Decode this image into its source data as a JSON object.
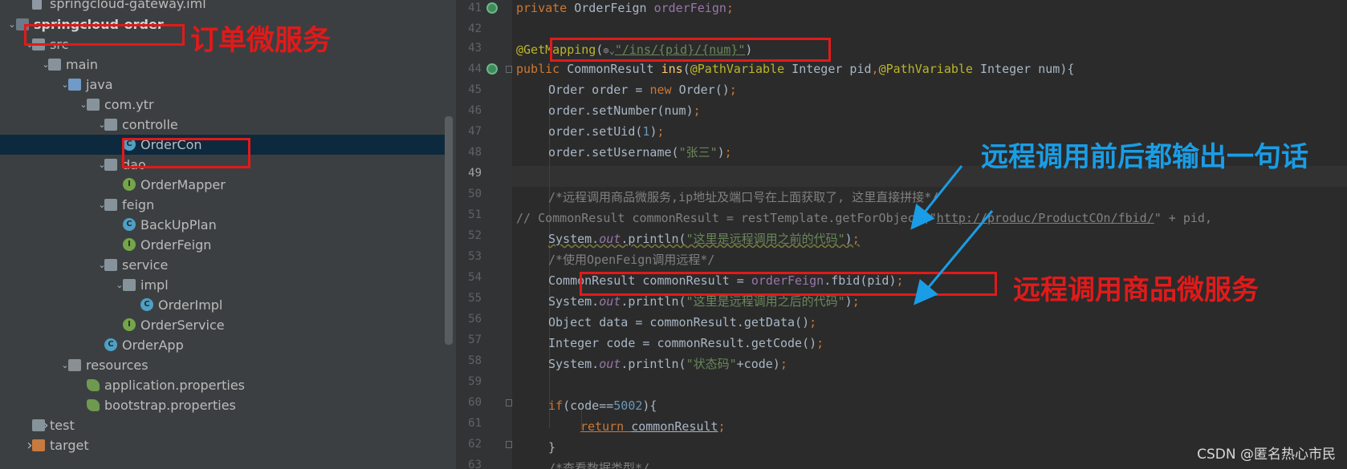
{
  "tree": {
    "items": [
      {
        "label": "springcloud-gateway.iml",
        "icon": "iml-file-icon",
        "arrow": ""
      },
      {
        "label": "springcloud-order",
        "icon": "module-folder-icon",
        "arrow": "expanded"
      },
      {
        "label": "src",
        "icon": "folder-icon",
        "arrow": "expanded"
      },
      {
        "label": "main",
        "icon": "folder-icon",
        "arrow": "expanded"
      },
      {
        "label": "java",
        "icon": "source-folder-icon",
        "arrow": "expanded"
      },
      {
        "label": "com.ytr",
        "icon": "package-icon",
        "arrow": "expanded"
      },
      {
        "label": "controlle",
        "icon": "package-icon",
        "arrow": "expanded"
      },
      {
        "label": "OrderCon",
        "icon": "class-icon",
        "arrow": ""
      },
      {
        "label": "dao",
        "icon": "package-icon",
        "arrow": "expanded"
      },
      {
        "label": "OrderMapper",
        "icon": "interface-icon",
        "arrow": ""
      },
      {
        "label": "feign",
        "icon": "package-icon",
        "arrow": "expanded"
      },
      {
        "label": "BackUpPlan",
        "icon": "class-icon",
        "arrow": ""
      },
      {
        "label": "OrderFeign",
        "icon": "interface-icon",
        "arrow": ""
      },
      {
        "label": "service",
        "icon": "package-icon",
        "arrow": "expanded"
      },
      {
        "label": "impl",
        "icon": "package-icon",
        "arrow": "expanded"
      },
      {
        "label": "OrderImpl",
        "icon": "class-icon",
        "arrow": ""
      },
      {
        "label": "OrderService",
        "icon": "interface-icon",
        "arrow": ""
      },
      {
        "label": "OrderApp",
        "icon": "spring-app-icon",
        "arrow": ""
      },
      {
        "label": "resources",
        "icon": "resources-folder-icon",
        "arrow": "expanded"
      },
      {
        "label": "application.properties",
        "icon": "properties-file-icon",
        "arrow": ""
      },
      {
        "label": "bootstrap.properties",
        "icon": "properties-file-icon",
        "arrow": ""
      },
      {
        "label": "test",
        "icon": "folder-icon",
        "arrow": "collapsed"
      },
      {
        "label": "target",
        "icon": "target-folder-icon",
        "arrow": "collapsed"
      }
    ],
    "class_icon_letter": "C",
    "interface_icon_letter": "I"
  },
  "editor": {
    "line_numbers": [
      "41",
      "42",
      "43",
      "44",
      "45",
      "46",
      "47",
      "48",
      "49",
      "50",
      "51",
      "52",
      "53",
      "54",
      "55",
      "56",
      "57",
      "58",
      "59",
      "60",
      "61",
      "62",
      "63"
    ],
    "current_line": "49",
    "code": {
      "l41_kw": "private ",
      "l41_type": "OrderFeign ",
      "l41_field": "orderFeign",
      "l41_end": ";",
      "l43_ann": "@GetMapping",
      "l43_open": "(",
      "l43_icon": "⊕⌄",
      "l43_str": "\"/ins/{pid}/{num}\"",
      "l43_close": ")",
      "l44_kw": "public ",
      "l44_sig1": "CommonResult ",
      "l44_meth": "ins",
      "l44_p1": "(",
      "l44_ann1": "@PathVariable",
      "l44_sig2": " Integer pid",
      "l44_comma": ",",
      "l44_ann2": "@PathVariable",
      "l44_sig3": " Integer num){",
      "l45_a": "Order order = ",
      "l45_kw": "new ",
      "l45_b": "Order()",
      "l45_end": ";",
      "l46_a": "order.setNumber(num)",
      "l46_end": ";",
      "l47_a": "order.setUid(",
      "l47_num": "1",
      "l47_b": ")",
      "l47_end": ";",
      "l48_a": "order.setUsername(",
      "l48_str": "\"张三\"",
      "l48_b": ")",
      "l48_end": ";",
      "l50_cmt": "/*远程调用商品微服务,ip地址及端口号在上面获取了, 这里直接拼接*/",
      "l51_cmt1": "// CommonResult commonResult = restTemplate.getForObject(\"",
      "l51_url": "http://produc/ProductCOn/fbid/",
      "l51_cmt2": "\" + pid,",
      "l52_a": "System.",
      "l52_out": "out",
      "l52_b": ".println(",
      "l52_str": "\"这里是远程调用之前的代码\"",
      "l52_c": ")",
      "l52_end": ";",
      "l53_cmt": "/*使用OpenFeign调用远程*/",
      "l54_a": "CommonResult commonResult = ",
      "l54_field": "orderFeign",
      "l54_b": ".fbid(pid)",
      "l54_end": ";",
      "l55_a": "System.",
      "l55_out": "out",
      "l55_b": ".println(",
      "l55_str": "\"这里是远程调用之后的代码\"",
      "l55_c": ")",
      "l55_end": ";",
      "l56_a": "Object data = commonResult.getData()",
      "l56_end": ";",
      "l57_a": "Integer code = commonResult.getCode()",
      "l57_end": ";",
      "l58_a": "System.",
      "l58_out": "out",
      "l58_b": ".println(",
      "l58_str": "\"状态码\"",
      "l58_c": "+code)",
      "l58_end": ";",
      "l60_kw": "if",
      "l60_a": "(code==",
      "l60_num": "5002",
      "l60_b": "){",
      "l61_kw": "return ",
      "l61_a": "commonResult",
      "l61_end": ";",
      "l62_a": "}",
      "l63_cmt": "/*查看数据类型*/"
    }
  },
  "annotations": {
    "order_service": "订单微服务",
    "print_note": "远程调用前后都输出一句话",
    "remote_call_note": "远程调用商品微服务"
  },
  "watermark": "CSDN @匿名热心市民",
  "colors": {
    "annotation_red": "#e11a1a",
    "annotation_blue": "#1a9de6",
    "selection": "#0d293e"
  }
}
